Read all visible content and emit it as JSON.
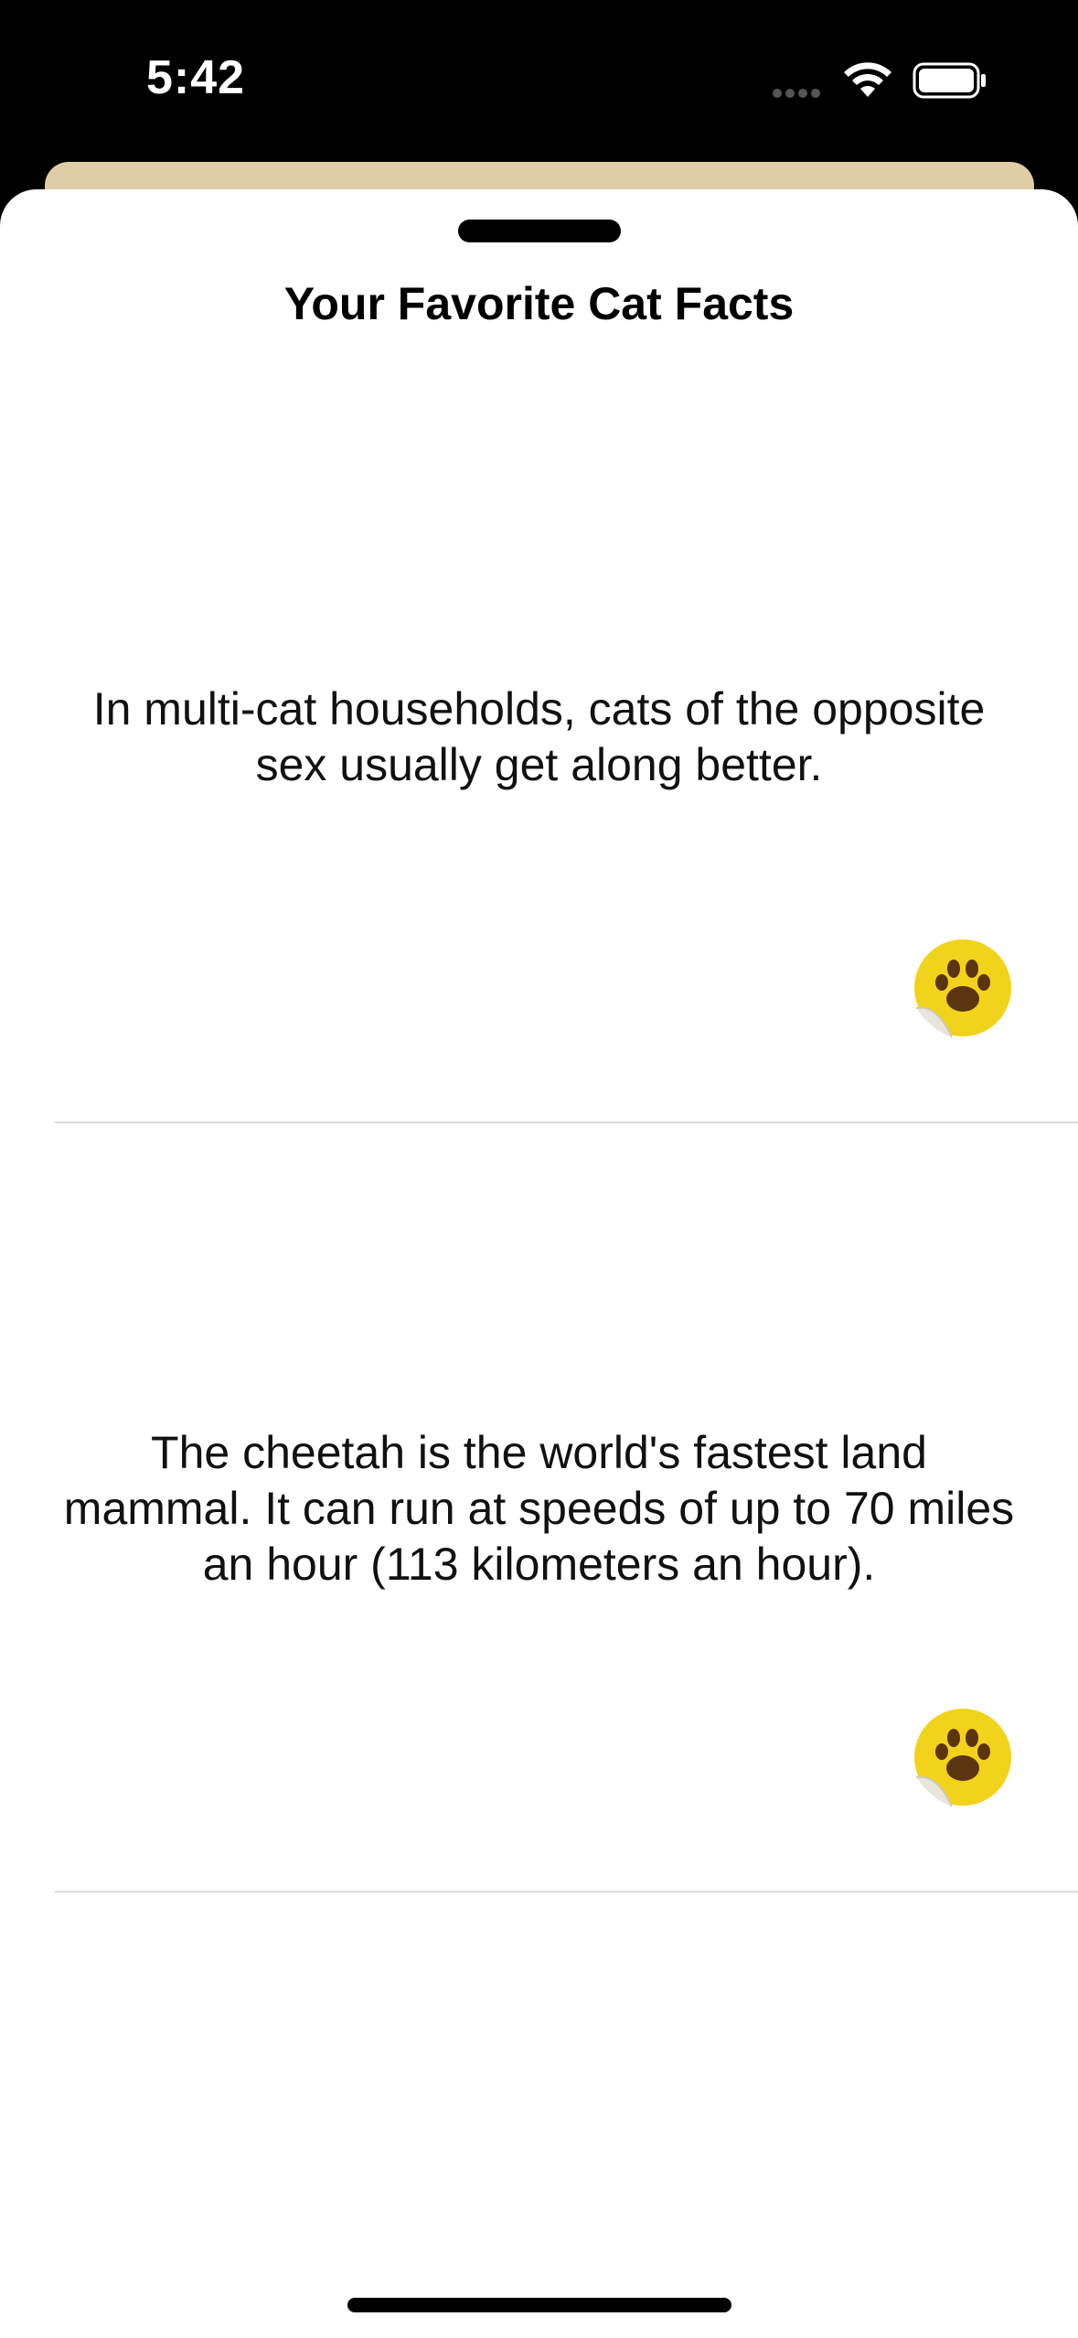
{
  "status_bar": {
    "time": "5:42"
  },
  "sheet": {
    "title": "Your Favorite Cat Facts"
  },
  "facts": [
    {
      "text": "In multi-cat households, cats of the opposite sex usually get along better.",
      "icon": "paw-sticker-icon"
    },
    {
      "text": "The cheetah is the world's fastest land mammal. It can run at speeds of up to 70 miles an hour (113 kilometers an hour).",
      "icon": "paw-sticker-icon"
    }
  ],
  "colors": {
    "parent_sheet": "#dfcda6",
    "sticker_yellow": "#f2d31b",
    "paw_brown": "#5a3510"
  }
}
